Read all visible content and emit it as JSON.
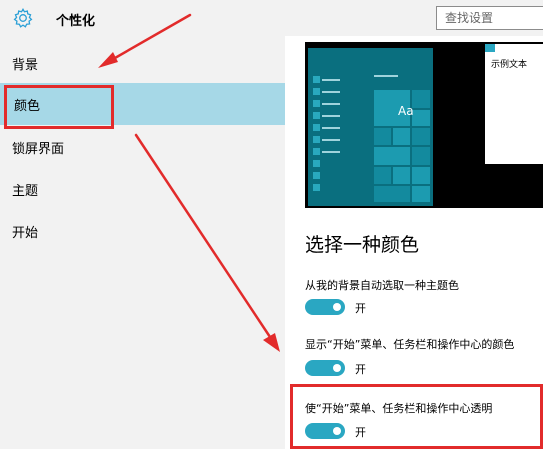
{
  "titlebar": {
    "app_icon": "gear-icon",
    "title": "个性化",
    "search_placeholder": "查找设置"
  },
  "sidebar": {
    "items": [
      {
        "label": "背景",
        "selected": false
      },
      {
        "label": "颜色",
        "selected": true
      },
      {
        "label": "锁屏界面",
        "selected": false
      },
      {
        "label": "主题",
        "selected": false
      },
      {
        "label": "开始",
        "selected": false
      }
    ]
  },
  "preview": {
    "tile_text": "Aa",
    "sample_text": "示例文本"
  },
  "main": {
    "section_title": "选择一种颜色",
    "options": [
      {
        "label": "从我的背景自动选取一种主题色",
        "state": "开",
        "on": true
      },
      {
        "label": "显示“开始”菜单、任务栏和操作中心的颜色",
        "state": "开",
        "on": true
      },
      {
        "label": "使“开始”菜单、任务栏和操作中心透明",
        "state": "开",
        "on": true
      }
    ]
  },
  "colors": {
    "accent": "#2aa7c2",
    "selected_nav": "#a6d8e7",
    "annotation": "#e22b2b"
  }
}
